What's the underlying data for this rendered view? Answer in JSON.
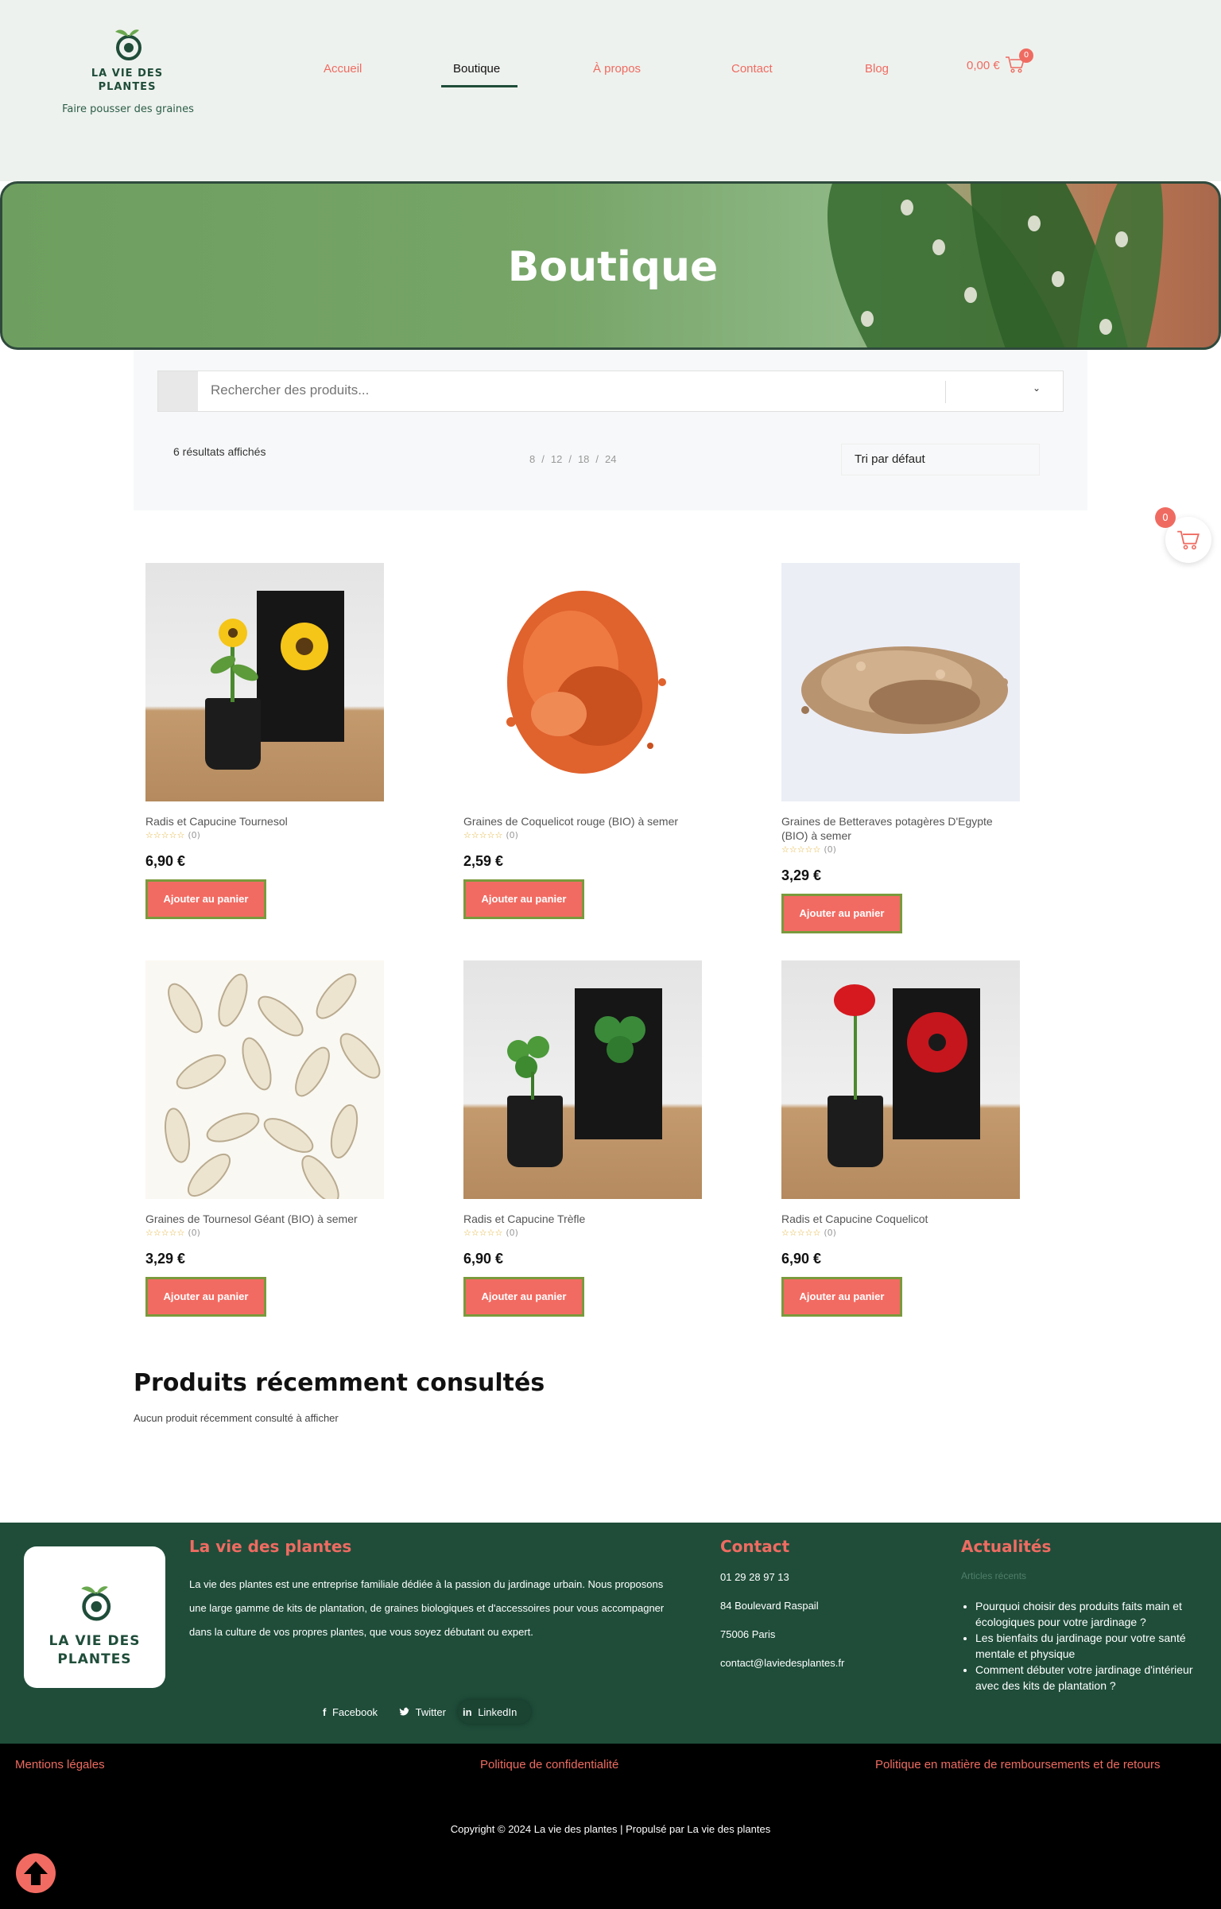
{
  "brand": {
    "logo_line1": "LA VIE DES",
    "logo_line2": "PLANTES",
    "tagline": "Faire pousser des graines",
    "logo_icon": "seedling-swirl-icon",
    "green": "#1f4d3a",
    "accent": "#ef6b61"
  },
  "nav": {
    "items": [
      {
        "label": "Accueil"
      },
      {
        "label": "Boutique"
      },
      {
        "label": "À propos"
      },
      {
        "label": "Contact"
      },
      {
        "label": "Blog"
      }
    ],
    "active": "Boutique",
    "cart_total": "0,00 €",
    "cart_count": "0"
  },
  "hero": {
    "title": "Boutique"
  },
  "shop_bar": {
    "search_placeholder": "Rechercher des produits...",
    "results": "6 résultats affichés",
    "per_page_options": [
      "8",
      "12",
      "18",
      "24"
    ],
    "sort_selected": "Tri par défaut"
  },
  "floating_cart": {
    "count": "0"
  },
  "products": [
    {
      "name": "Radis et Capucine Tournesol",
      "rating_count": "(0)",
      "price": "6,90 €",
      "button": "Ajouter au panier"
    },
    {
      "name": "Graines de Coquelicot rouge (BIO) à semer",
      "rating_count": "(0)",
      "price": "2,59 €",
      "button": "Ajouter au panier"
    },
    {
      "name": "Graines de Betteraves potagères D'Egypte (BIO) à semer",
      "rating_count": "(0)",
      "price": "3,29 €",
      "button": "Ajouter au panier"
    },
    {
      "name": "Graines de Tournesol Géant (BIO) à semer",
      "rating_count": "(0)",
      "price": "3,29 €",
      "button": "Ajouter au panier"
    },
    {
      "name": "Radis et Capucine Trèfle",
      "rating_count": "(0)",
      "price": "6,90 €",
      "button": "Ajouter au panier"
    },
    {
      "name": "Radis et Capucine Coquelicot",
      "rating_count": "(0)",
      "price": "6,90 €",
      "button": "Ajouter au panier"
    }
  ],
  "recent": {
    "title": "Produits récemment consultés",
    "empty": "Aucun produit récemment consulté à afficher"
  },
  "footer": {
    "about_title": "La vie des plantes",
    "about_text": "La vie des plantes est une entreprise familiale dédiée à la passion du jardinage urbain. Nous proposons une large gamme de kits de plantation, de graines biologiques et d'accessoires pour vous accompagner dans la culture de vos propres plantes, que vous soyez débutant ou expert.",
    "contact_title": "Contact",
    "phone": "01 29 28 97 13",
    "address": "84 Boulevard Raspail",
    "city": "75006  Paris",
    "email": "contact@laviedesplantes.fr",
    "news_title": "Actualités",
    "news_sub": "Articles récents",
    "news": [
      "Pourquoi choisir des produits faits main et écologiques pour votre jardinage ?",
      "Les bienfaits du jardinage pour votre santé mentale et physique",
      "Comment débuter votre jardinage d'intérieur avec des kits de plantation ?"
    ],
    "social": [
      "Facebook",
      "Twitter",
      "LinkedIn"
    ]
  },
  "legal": {
    "mentions": "Mentions légales",
    "privacy": "Politique de confidentialité",
    "refund": "Politique en matière de remboursements et de retours",
    "copyright": "Copyright © 2024 La vie des plantes | Propulsé par La vie des plantes"
  }
}
